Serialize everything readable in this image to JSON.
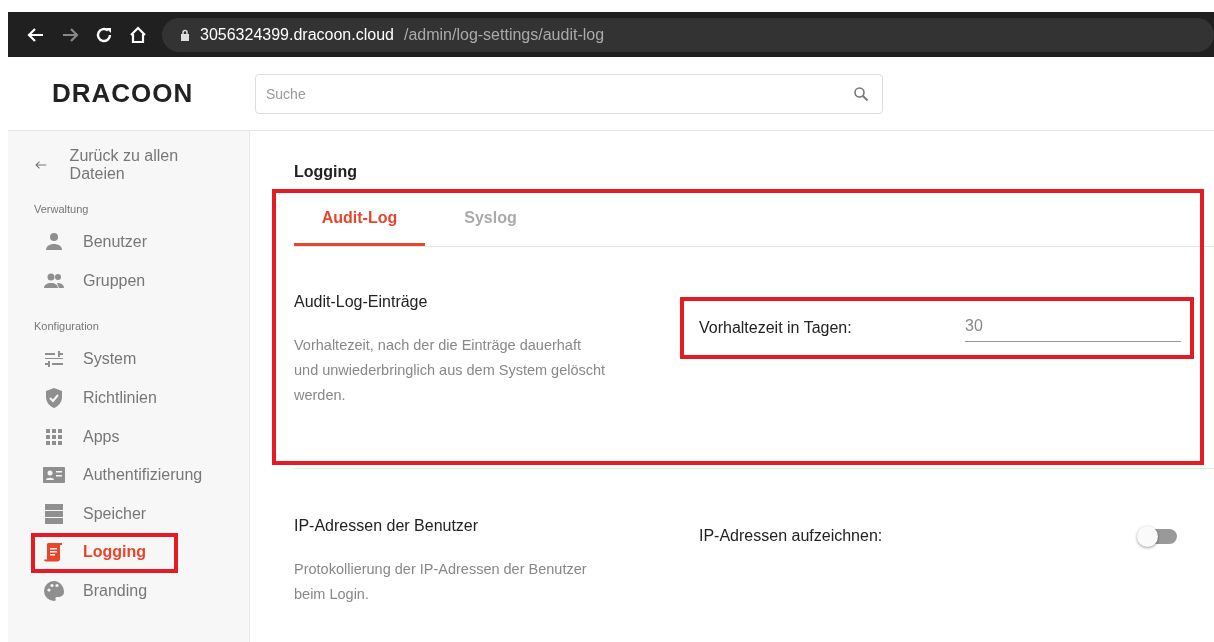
{
  "browser": {
    "url_host": "3056324399.dracoon.cloud",
    "url_path": "/admin/log-settings/audit-log"
  },
  "header": {
    "logo": "DRACOON",
    "search": {
      "placeholder": "Suche"
    }
  },
  "sidebar": {
    "back": "Zurück zu allen Dateien",
    "groups": [
      {
        "title": "Verwaltung",
        "items": [
          {
            "label": "Benutzer",
            "kind": "user",
            "selected": false
          },
          {
            "label": "Gruppen",
            "kind": "group",
            "selected": false
          }
        ]
      },
      {
        "title": "Konfiguration",
        "items": [
          {
            "label": "System",
            "kind": "sliders",
            "selected": false
          },
          {
            "label": "Richtlinien",
            "kind": "shield",
            "selected": false
          },
          {
            "label": "Apps",
            "kind": "grid",
            "selected": false
          },
          {
            "label": "Authentifizierung",
            "kind": "card",
            "selected": false
          },
          {
            "label": "Speicher",
            "kind": "server",
            "selected": false
          },
          {
            "label": "Logging",
            "kind": "scroll",
            "selected": true
          },
          {
            "label": "Branding",
            "kind": "palette",
            "selected": false
          }
        ]
      }
    ]
  },
  "page": {
    "title": "Logging",
    "tabs": [
      {
        "label": "Audit-Log",
        "selected": true
      },
      {
        "label": "Syslog",
        "selected": false
      }
    ],
    "sections": [
      {
        "kind": "field",
        "title": "Audit-Log-Einträge",
        "description": "Vorhaltezeit, nach der die Einträge dauerhaft und unwiederbringlich aus dem System gelöscht werden.",
        "label": "Vorhaltezeit in Tagen:",
        "value": "30"
      },
      {
        "kind": "toggle",
        "title": "IP-Adressen der Benutzer",
        "description": "Protokollierung der IP-Adressen der Benutzer beim Login.",
        "label": "IP-Adressen aufzeichnen:",
        "on": false
      }
    ]
  }
}
